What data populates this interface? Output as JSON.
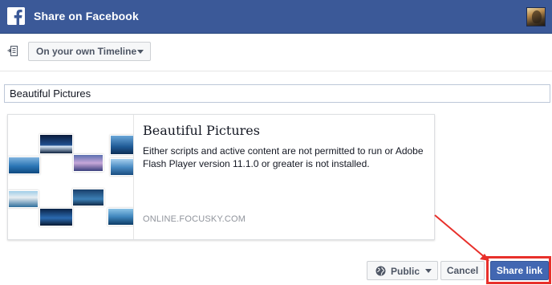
{
  "header": {
    "title": "Share on Facebook",
    "logo_icon": "facebook-logo-icon",
    "avatar_icon": "user-avatar"
  },
  "audience": {
    "icon": "share-post-icon",
    "selected": "On your own Timeline"
  },
  "message": {
    "value": "Beautiful Pictures"
  },
  "link_preview": {
    "title": "Beautiful Pictures",
    "description": "Either scripts and active content are not permitted to run or Adobe Flash Player version 11.1.0 or greater is not installed.",
    "domain": "ONLINE.FOCUSKY.COM",
    "thumbnail_icon": "image-collage-thumbnail"
  },
  "footer": {
    "privacy_label": "Public",
    "privacy_icon": "globe-icon",
    "cancel_label": "Cancel",
    "share_label": "Share link"
  },
  "colors": {
    "brand": "#3b5998",
    "primary_button": "#4267b2",
    "annotation": "#e8302b"
  }
}
